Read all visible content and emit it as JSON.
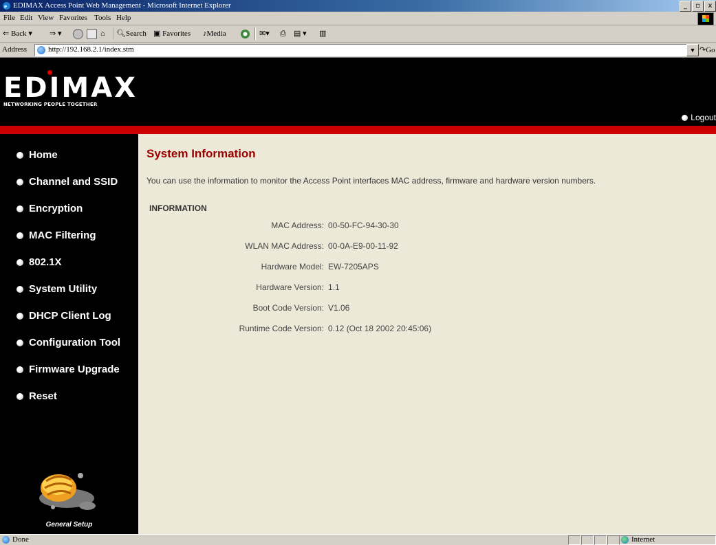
{
  "window": {
    "title": "EDIMAX Access Point Web Management - Microsoft Internet Explorer",
    "minimize": "_",
    "maximize": "▫",
    "close": "x"
  },
  "menubar": [
    "File",
    "Edit",
    "View",
    "Favorites",
    "Tools",
    "Help"
  ],
  "toolbar": {
    "back": "Back",
    "search": "Search",
    "favorites": "Favorites",
    "media": "Media"
  },
  "address": {
    "label": "Address",
    "url": "http://192.168.2.1/index.stm",
    "go": "Go"
  },
  "brand": {
    "logo": "EDIMAX",
    "tagline": "NETWORKING PEOPLE TOGETHER",
    "logout": "Logout"
  },
  "sidebar": {
    "items": [
      {
        "label": "Home"
      },
      {
        "label": "Channel and SSID"
      },
      {
        "label": "Encryption"
      },
      {
        "label": "MAC Filtering"
      },
      {
        "label": "802.1X"
      },
      {
        "label": "System Utility"
      },
      {
        "label": "DHCP Client Log"
      },
      {
        "label": "Configuration Tool"
      },
      {
        "label": "Firmware Upgrade"
      },
      {
        "label": "Reset"
      }
    ],
    "setup_label": "General Setup"
  },
  "main": {
    "heading": "System Information",
    "description": "You can use the information to monitor the Access Point interfaces MAC address, firmware and hardware version numbers.",
    "section_title": "INFORMATION",
    "rows": [
      {
        "label": "MAC Address:",
        "value": "00-50-FC-94-30-30"
      },
      {
        "label": "WLAN MAC Address:",
        "value": "00-0A-E9-00-11-92"
      },
      {
        "label": "Hardware Model:",
        "value": "EW-7205APS"
      },
      {
        "label": "Hardware Version:",
        "value": "1.1"
      },
      {
        "label": "Boot Code Version:",
        "value": "V1.06"
      },
      {
        "label": "Runtime Code Version:",
        "value": "0.12 (Oct 18 2002 20:45:06)"
      }
    ]
  },
  "statusbar": {
    "status": "Done",
    "zone": "Internet"
  },
  "colors": {
    "heading": "#990000",
    "redbar": "#cc0000",
    "content_bg": "#ece9d8"
  }
}
